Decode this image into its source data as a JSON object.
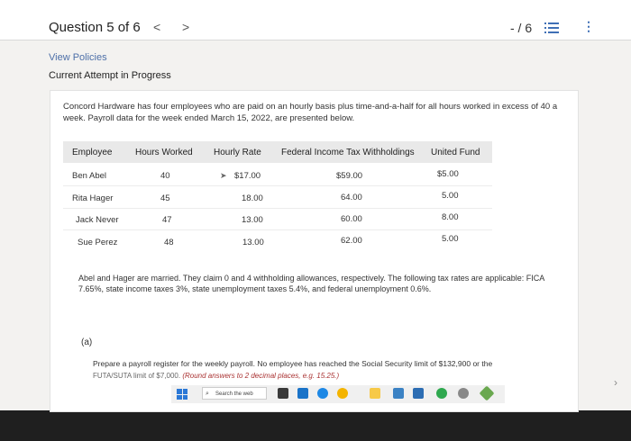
{
  "header": {
    "question_title": "Question 5 of 6",
    "prev": "<",
    "next": ">",
    "score": "- / 6",
    "list_icon": "list-icon",
    "more_icon": "more-vertical-icon"
  },
  "links": {
    "view_policies": "View Policies",
    "current_attempt": "Current Attempt in Progress"
  },
  "problem": {
    "intro": "Concord Hardware has four employees who are paid on an hourly basis plus time-and-a-half for all hours worked in excess of 40 a week. Payroll data for the week ended March 15, 2022, are presented below.",
    "table": {
      "headers": [
        "Employee",
        "Hours Worked",
        "Hourly Rate",
        "Federal Income Tax Withholdings",
        "United Fund"
      ],
      "rows": [
        [
          "Ben Abel",
          "40",
          "$17.00",
          "$59.00",
          "$5.00"
        ],
        [
          "Rita Hager",
          "45",
          "18.00",
          "64.00",
          "5.00"
        ],
        [
          "Jack Never",
          "47",
          "13.00",
          "60.00",
          "8.00"
        ],
        [
          "Sue Perez",
          "48",
          "13.00",
          "62.00",
          "5.00"
        ]
      ]
    },
    "note": "Abel and Hager are married. They claim 0 and 4 withholding allowances, respectively. The following tax rates are applicable: FICA 7.65%, state income taxes 3%, state unemployment taxes 5.4%, and federal unemployment 0.6%.",
    "part_label": "(a)",
    "prepare": "Prepare a payroll register for the weekly payroll. No employee has reached the Social Security limit of $132,900 or the",
    "prepare_cont_plain": "FUTA/SUTA limit of $7,000.",
    "prepare_cont_hint": "(Round answers to 2 decimal places, e.g. 15.25.)"
  },
  "taskbar": {
    "search_placeholder": "Search the web",
    "colors": {
      "accent_blue": "#2b78d6",
      "link_blue": "#4d6fa8"
    }
  }
}
